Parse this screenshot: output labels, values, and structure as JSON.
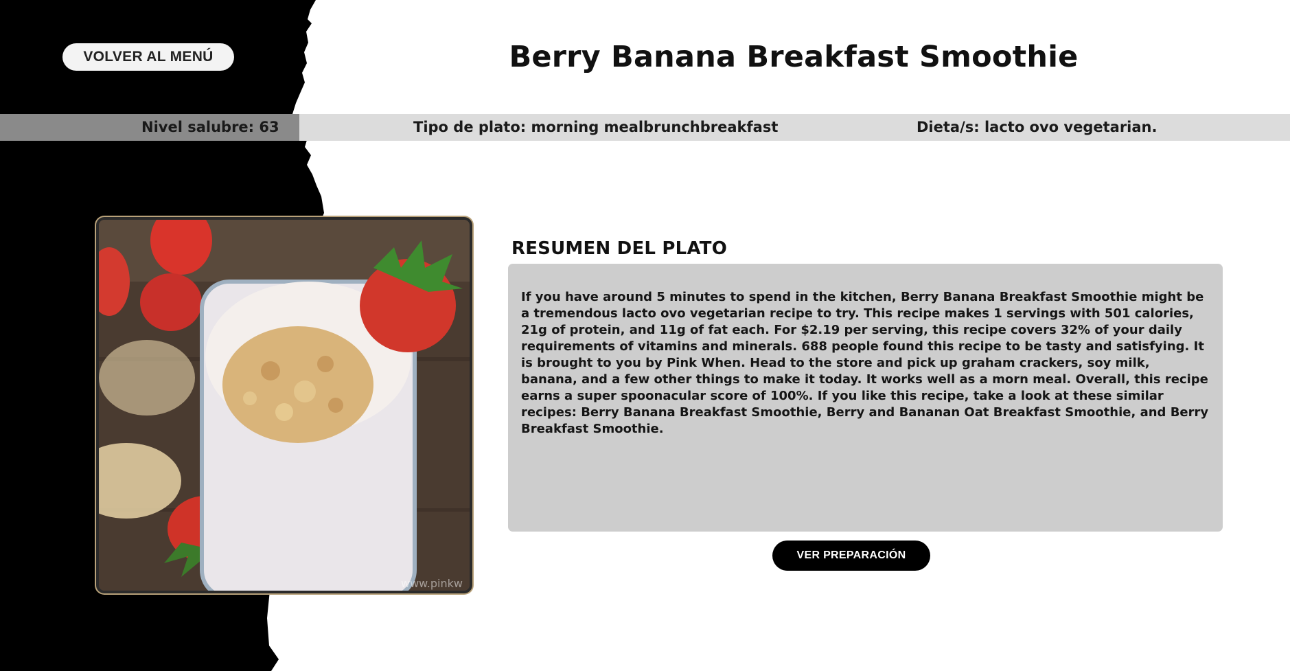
{
  "header": {
    "back_button_label": "VOLVER AL MENÚ",
    "title": "Berry Banana Breakfast Smoothie"
  },
  "info_bar": {
    "health": "Nivel salubre: 63",
    "dish_type": "Tipo de plato: morning mealbrunchbreakfast",
    "diets": "Dieta/s: lacto ovo vegetarian."
  },
  "image": {
    "watermark": "www.pinkw"
  },
  "summary": {
    "heading": "RESUMEN DEL PLATO",
    "text": "If you have around 5 minutes to spend in the kitchen, Berry Banana Breakfast Smoothie might be a tremendous lacto ovo vegetarian recipe to try. This recipe makes 1 servings with 501 calories, 21g of protein, and 11g of fat each. For $2.19 per serving, this recipe covers 32% of your daily requirements of vitamins and minerals. 688 people found this recipe to be tasty and satisfying. It is brought to you by Pink When. Head to the store and pick up graham crackers, soy milk, banana, and a few other things to make it today. It works well as a morn meal. Overall, this recipe earns a super spoonacular score of 100%. If you like this recipe, take a look at these similar recipes: Berry Banana Breakfast Smoothie, Berry and Bananan Oat Breakfast Smoothie, and Berry Breakfast Smoothie."
  },
  "actions": {
    "prep_button_label": "VER PREPARACIÓN"
  },
  "colors": {
    "background_dark": "#000000",
    "background_light": "#ffffff",
    "info_bar": "#dcdcdc",
    "summary_box": "#cdcdcd",
    "button_dark": "#000000"
  }
}
